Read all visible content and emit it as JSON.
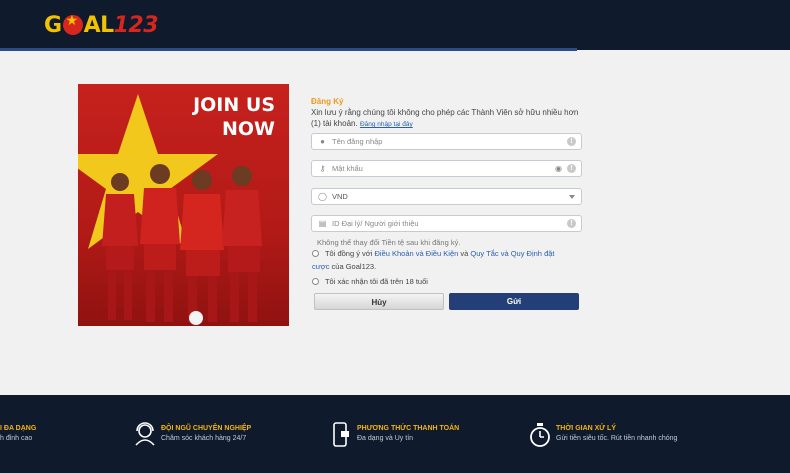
{
  "header": {
    "logo_text": "GOAL123"
  },
  "banner": {
    "line1": "JOIN US",
    "line2": "NOW"
  },
  "form": {
    "title": "Đăng Ký",
    "note": "Xin lưu ý rằng chúng tôi không cho phép các Thành Viên sở hữu nhiều hơn (1) tài khoản.",
    "note_link": "Đăng nhập tại đây",
    "username_placeholder": "Tên đăng nhập",
    "password_placeholder": "Mật khẩu",
    "currency_value": "VND",
    "agent_placeholder": "ID Đại lý/ Người giới thiệu",
    "currency_hint": "Không thể thay đổi Tiền tệ sau khi đăng ký.",
    "terms_prefix": "Tôi đồng ý với",
    "terms_link1": "Điều Khoản và Điều Kiện",
    "terms_and": "và",
    "terms_link2": "Quy Tắc và Quy Định đặt cược",
    "terms_suffix": "của Goal123.",
    "age_confirm": "Tôi xác nhận tôi đã trên 18 tuổi",
    "cancel_label": "Hủy",
    "submit_label": "Gửi"
  },
  "footer": {
    "features": [
      {
        "title": "I ĐA DẠNG",
        "desc": "h đỉnh cao",
        "icon": "partial-icon"
      },
      {
        "title": "ĐỘI NGŨ CHUYÊN NGHIỆP",
        "desc": "Chăm sóc khách hàng 24/7",
        "icon": "support-headset-icon"
      },
      {
        "title": "PHƯƠNG THỨC THANH TOÁN",
        "desc": "Đa dạng và Uy tín",
        "icon": "mobile-payment-icon"
      },
      {
        "title": "THỜI GIAN XỬ LÝ",
        "desc": "Gửi tiền siêu tốc. Rút tiền nhanh chóng",
        "icon": "stopwatch-icon"
      }
    ]
  },
  "colors": {
    "header_bg": "#0f1a2c",
    "accent_gold": "#f2b418",
    "form_title": "#e89a1a",
    "submit_bg": "#243f78",
    "link": "#2a5db0"
  }
}
